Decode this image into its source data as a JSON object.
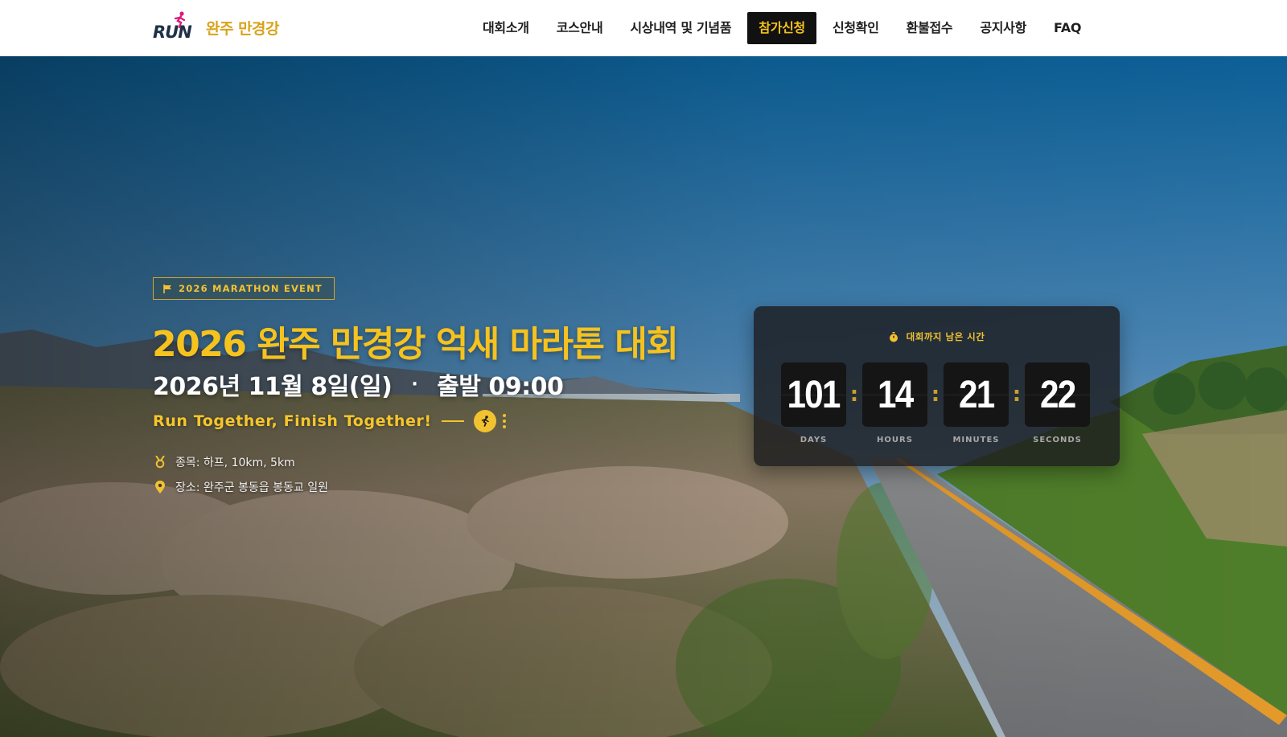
{
  "header": {
    "logo_mark": "RUN",
    "logo_text": "완주 만경강",
    "nav": [
      {
        "label": "대회소개"
      },
      {
        "label": "코스안내"
      },
      {
        "label": "시상내역 및 기념품"
      },
      {
        "label": "참가신청",
        "active": true
      },
      {
        "label": "신청확인"
      },
      {
        "label": "환불접수"
      },
      {
        "label": "공지사항"
      },
      {
        "label": "FAQ"
      }
    ]
  },
  "hero": {
    "badge": "2026 MARATHON EVENT",
    "title": "2026 완주 만경강 억새 마라톤 대회",
    "date": "2026년 11월 8일(일)",
    "date_separator": "·",
    "start_time": "출발 09:00",
    "slogan": "Run Together, Finish Together!",
    "info": {
      "events": "종목: 하프, 10km, 5km",
      "venue": "장소: 완주군 봉동읍 봉동교 일원"
    }
  },
  "countdown": {
    "heading": "대회까지 남은 시간",
    "units": [
      {
        "value": "101",
        "label": "DAYS"
      },
      {
        "value": "14",
        "label": "HOURS"
      },
      {
        "value": "21",
        "label": "MINUTES"
      },
      {
        "value": "22",
        "label": "SECONDS"
      }
    ],
    "separator": ":"
  },
  "colors": {
    "accent": "#f2c230",
    "logo_dark": "#1f3147",
    "logo_gold": "#d9a21b",
    "nav_active_bg": "#111111"
  },
  "icons": [
    "runner-icon",
    "flag-icon",
    "stopwatch-icon",
    "medal-icon",
    "location-pin-icon"
  ]
}
